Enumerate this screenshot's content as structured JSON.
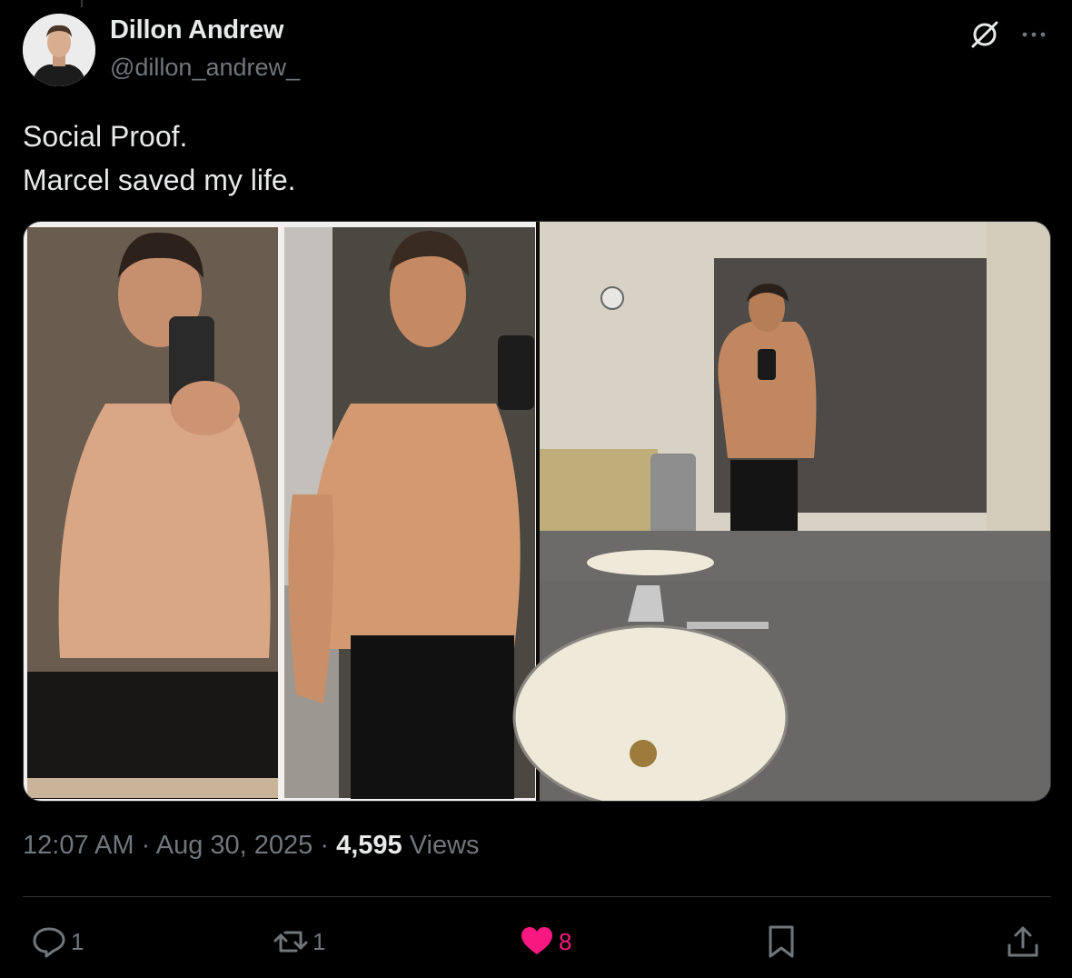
{
  "author": {
    "display_name": "Dillon Andrew",
    "handle": "@dillon_andrew_"
  },
  "header_icons": [
    "grok-icon",
    "more-icon"
  ],
  "tweet": {
    "lines": [
      "Social Proof.",
      "Marcel saved my life."
    ]
  },
  "meta": {
    "time": "12:07 AM",
    "separator": "·",
    "date": "Aug 30, 2025",
    "views_count": "4,595",
    "views_label": "Views"
  },
  "actions": {
    "reply": {
      "icon": "reply-icon",
      "count": "1"
    },
    "repost": {
      "icon": "repost-icon",
      "count": "1"
    },
    "like": {
      "icon": "heart-icon",
      "count": "8",
      "active": true
    },
    "bookmark": {
      "icon": "bookmark-icon"
    },
    "share": {
      "icon": "share-icon"
    }
  },
  "colors": {
    "background": "#000000",
    "text_primary": "#e7e9ea",
    "text_secondary": "#71767b",
    "divider": "#2f3336",
    "like_active": "#f91880"
  }
}
